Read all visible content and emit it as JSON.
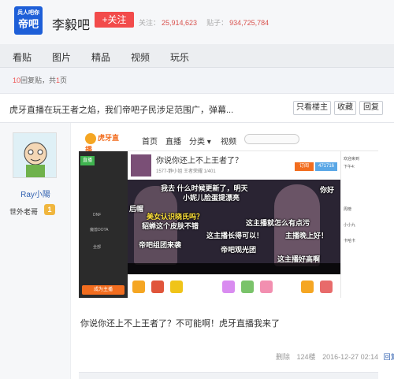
{
  "header": {
    "logo_line1": "兵人吧你",
    "logo_line2": "帝吧",
    "forum_name": "李毅吧",
    "follow_label": "+关注",
    "follow_count_label": "关注：",
    "follow_count": "25,914,623",
    "post_count_label": "贴子：",
    "post_count": "934,725,784"
  },
  "nav": {
    "items": [
      "看贴",
      "图片",
      "精品",
      "视频",
      "玩乐"
    ]
  },
  "meta": {
    "reply_count": "10",
    "reply_label": "回复贴，共",
    "page_count": "1",
    "page_label": "页"
  },
  "thread": {
    "title": "虎牙直播在玩王者之焰，我们帝吧子民涉足范围广，弹幕...",
    "buttons": {
      "only_author": "只看楼主",
      "favorite": "收藏",
      "reply": "回复"
    }
  },
  "author": {
    "name": "Ray小陽",
    "level_name": "世外老哥",
    "level": "1"
  },
  "screenshot": {
    "site_logo": "虎牙直播",
    "nav_items": [
      "首页",
      "直播",
      "分类 ▾",
      "视频"
    ],
    "sidebar_badge": "直播",
    "sidebar_menu": [
      "DNF",
      "魔兽DOTA",
      "全部"
    ],
    "sidebar_button": "成为主播",
    "room_title": "你说你还上不上王者了？",
    "room_sub": "1577-静小姐   王者荣耀   1/401",
    "orange_btn": "订阅",
    "blue_btn": "471716",
    "right_panel": [
      "欢迎来到",
      "下午4:",
      "周榜",
      "小小九",
      "卡哈卡"
    ],
    "danmu": [
      {
        "text": "我去 什么时候更新了，明天",
        "color": "#ffffff"
      },
      {
        "text": "小妮儿脸蛋提漂亮",
        "color": "#ffffff"
      },
      {
        "text": "后帽",
        "color": "#ffffff"
      },
      {
        "text": "美女认识晓氏吗？",
        "color": "#ffe23a"
      },
      {
        "text": "貂蝉这个皮肤不错",
        "color": "#ffffff"
      },
      {
        "text": "这主播长得可以！",
        "color": "#ffffff"
      },
      {
        "text": "这主播就怎么有点污",
        "color": "#ffffff"
      },
      {
        "text": "主播晚上好！",
        "color": "#ffffff"
      },
      {
        "text": "帝吧组团来袭",
        "color": "#ffffff"
      },
      {
        "text": "帝吧观光团",
        "color": "#ffffff"
      },
      {
        "text": "这主播好高啊",
        "color": "#ffffff"
      },
      {
        "text": "你好",
        "color": "#ffffff"
      }
    ]
  },
  "post": {
    "body": "你说你还上不上王者了？不可能啊！虎牙直播我来了",
    "delete_label": "删除",
    "floor": "124楼",
    "time": "2016-12-27 02:14",
    "reply_label": "回复"
  },
  "colors": {
    "brand_blue": "#1e5fd8",
    "follow_red": "#f24b4b",
    "link_blue": "#3060b0",
    "huya_orange": "#f26d1f"
  }
}
